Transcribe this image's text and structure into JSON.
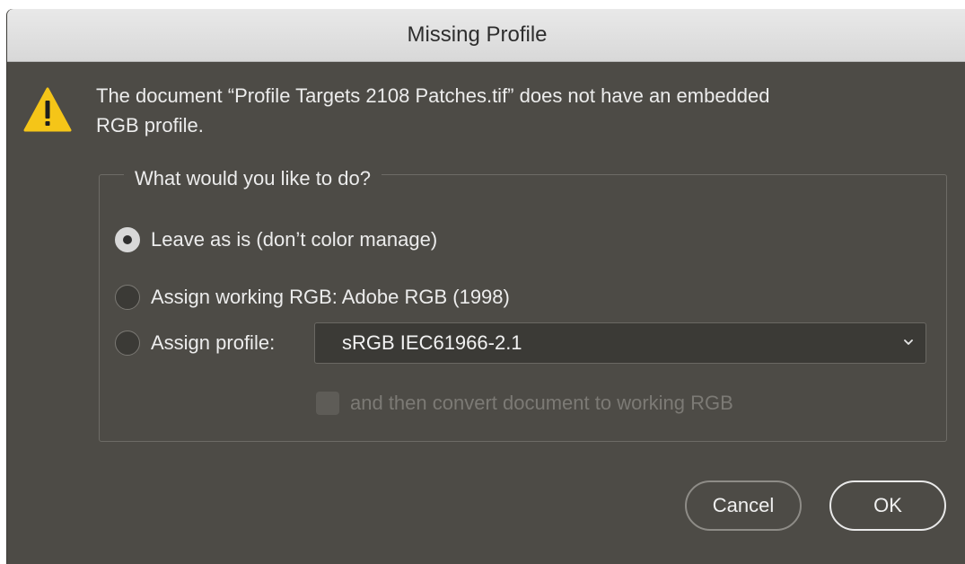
{
  "dialog": {
    "title": "Missing Profile",
    "message_line1": "The document “Profile Targets 2108 Patches.tif” does not have an embedded",
    "message_line2": "RGB profile.",
    "group_legend": "What would you like to do?",
    "options": [
      {
        "label": "Leave as is (don’t color manage)",
        "selected": true
      },
      {
        "label": "Assign working RGB:  Adobe RGB (1998)",
        "selected": false
      },
      {
        "label": "Assign profile:",
        "selected": false
      }
    ],
    "profile_select_value": "sRGB IEC61966-2.1",
    "convert_checkbox_label": "and then convert document to working RGB",
    "convert_checkbox_checked": false,
    "convert_checkbox_enabled": false,
    "buttons": {
      "cancel": "Cancel",
      "ok": "OK"
    }
  },
  "colors": {
    "dialog_bg": "#4d4b46",
    "warning_yellow": "#f5c518",
    "text": "#ececec"
  },
  "icons": {
    "warning": "warning-icon",
    "chevron": "chevron-down-icon"
  }
}
